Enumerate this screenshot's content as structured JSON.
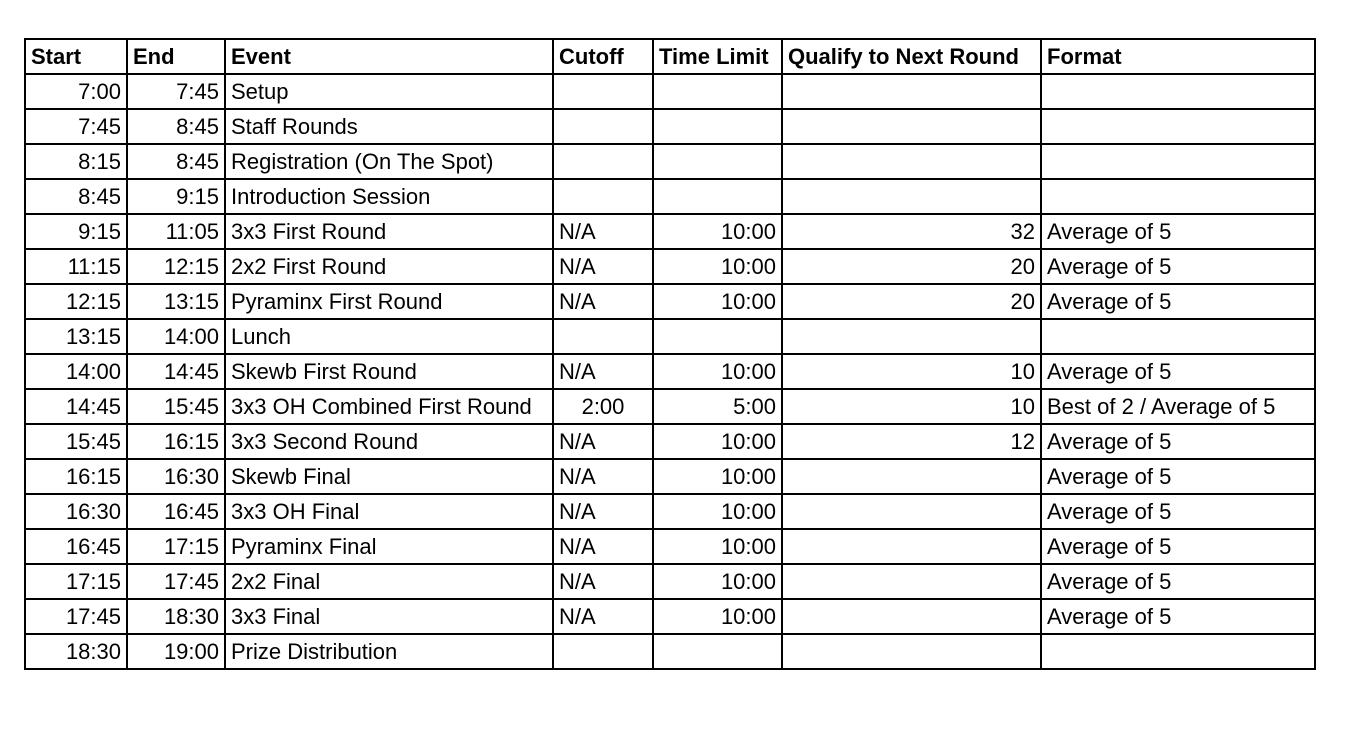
{
  "headers": {
    "start": "Start",
    "end": "End",
    "event": "Event",
    "cutoff": "Cutoff",
    "time_limit": "Time Limit",
    "qualify": "Qualify to Next Round",
    "format": "Format"
  },
  "rows": [
    {
      "start": "7:00",
      "end": "7:45",
      "event": "Setup",
      "cutoff": "",
      "time_limit": "",
      "qualify": "",
      "format": ""
    },
    {
      "start": "7:45",
      "end": "8:45",
      "event": "Staff Rounds",
      "cutoff": "",
      "time_limit": "",
      "qualify": "",
      "format": ""
    },
    {
      "start": "8:15",
      "end": "8:45",
      "event": "Registration (On The Spot)",
      "cutoff": "",
      "time_limit": "",
      "qualify": "",
      "format": ""
    },
    {
      "start": "8:45",
      "end": "9:15",
      "event": "Introduction Session",
      "cutoff": "",
      "time_limit": "",
      "qualify": "",
      "format": ""
    },
    {
      "start": "9:15",
      "end": "11:05",
      "event": "3x3 First Round",
      "cutoff": "N/A",
      "time_limit": "10:00",
      "qualify": "32",
      "format": "Average of 5"
    },
    {
      "start": "11:15",
      "end": "12:15",
      "event": "2x2 First Round",
      "cutoff": "N/A",
      "time_limit": "10:00",
      "qualify": "20",
      "format": "Average of 5"
    },
    {
      "start": "12:15",
      "end": "13:15",
      "event": "Pyraminx First Round",
      "cutoff": "N/A",
      "time_limit": "10:00",
      "qualify": "20",
      "format": "Average of 5"
    },
    {
      "start": "13:15",
      "end": "14:00",
      "event": "Lunch",
      "cutoff": "",
      "time_limit": "",
      "qualify": "",
      "format": ""
    },
    {
      "start": "14:00",
      "end": "14:45",
      "event": "Skewb First Round",
      "cutoff": "N/A",
      "time_limit": "10:00",
      "qualify": "10",
      "format": "Average of 5"
    },
    {
      "start": "14:45",
      "end": "15:45",
      "event": "3x3 OH Combined First Round",
      "cutoff": "2:00",
      "time_limit": "5:00",
      "qualify": "10",
      "format": "Best of 2 / Average of 5"
    },
    {
      "start": "15:45",
      "end": "16:15",
      "event": "3x3 Second Round",
      "cutoff": "N/A",
      "time_limit": "10:00",
      "qualify": "12",
      "format": "Average of 5"
    },
    {
      "start": "16:15",
      "end": "16:30",
      "event": "Skewb Final",
      "cutoff": "N/A",
      "time_limit": "10:00",
      "qualify": "",
      "format": "Average of 5"
    },
    {
      "start": "16:30",
      "end": "16:45",
      "event": "3x3 OH Final",
      "cutoff": "N/A",
      "time_limit": "10:00",
      "qualify": "",
      "format": "Average of 5"
    },
    {
      "start": "16:45",
      "end": "17:15",
      "event": "Pyraminx Final",
      "cutoff": "N/A",
      "time_limit": "10:00",
      "qualify": "",
      "format": "Average of 5"
    },
    {
      "start": "17:15",
      "end": "17:45",
      "event": "2x2 Final",
      "cutoff": "N/A",
      "time_limit": "10:00",
      "qualify": "",
      "format": "Average of 5"
    },
    {
      "start": "17:45",
      "end": "18:30",
      "event": "3x3 Final",
      "cutoff": "N/A",
      "time_limit": "10:00",
      "qualify": "",
      "format": "Average of 5"
    },
    {
      "start": "18:30",
      "end": "19:00",
      "event": "Prize Distribution",
      "cutoff": "",
      "time_limit": "",
      "qualify": "",
      "format": ""
    }
  ]
}
